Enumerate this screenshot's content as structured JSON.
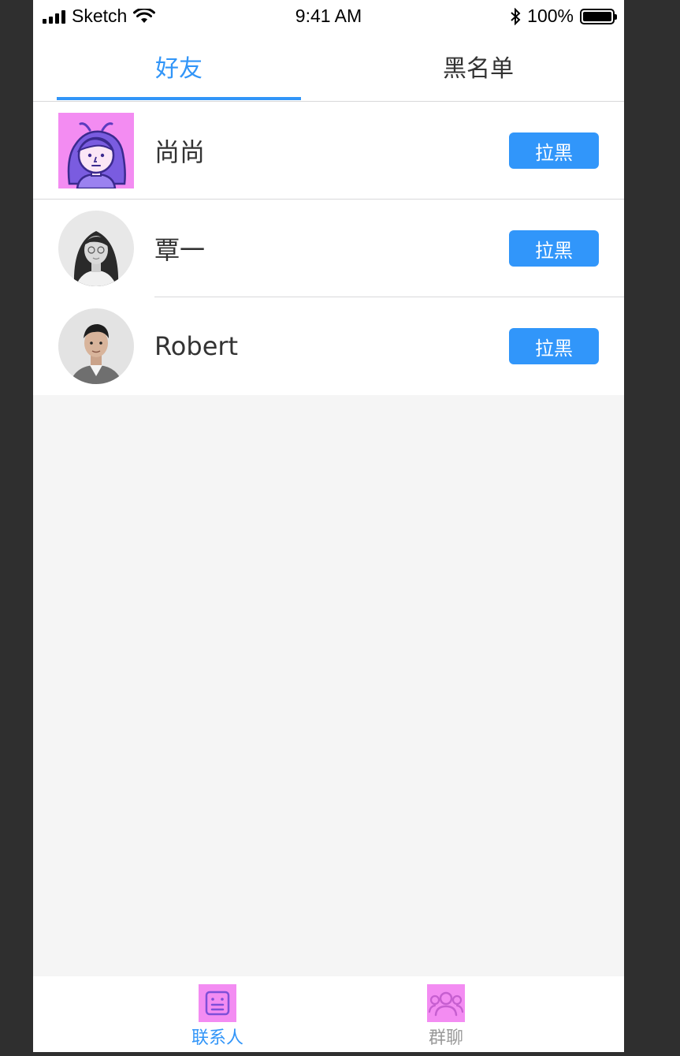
{
  "status_bar": {
    "carrier": "Sketch",
    "time": "9:41 AM",
    "battery": "100%"
  },
  "tabs": {
    "friends_label": "好友",
    "blacklist_label": "黑名单",
    "active_color": "#3195f8",
    "inactive_color": "#333333"
  },
  "friends": [
    {
      "name": "尚尚",
      "action": "拉黑",
      "avatar": "cartoon-girl-avatar"
    },
    {
      "name": "覃一",
      "action": "拉黑",
      "avatar": "woman-photo-avatar"
    },
    {
      "name": "Robert",
      "action": "拉黑",
      "avatar": "man-photo-avatar"
    }
  ],
  "colors": {
    "button_fill": "#3196fa",
    "divider": "#d8d8da",
    "page_bg": "#f5f5f5",
    "text": "#333333",
    "button_text": "#ffffff"
  },
  "bottom_tabbar": {
    "contacts_label": "联系人",
    "contacts_icon": "contacts-icon",
    "groups_label": "群聊",
    "groups_icon": "group-chat-icon"
  }
}
